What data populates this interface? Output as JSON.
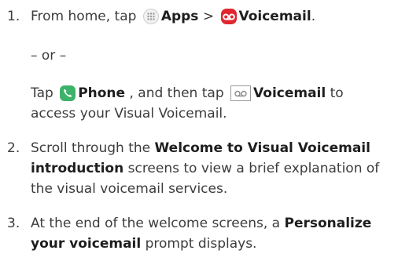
{
  "steps": [
    {
      "number": "1.",
      "line1": {
        "pre": "From home, tap",
        "apps": "Apps",
        "sep": ">",
        "voicemail": "Voicemail",
        "end": "."
      },
      "or": "– or –",
      "line2": {
        "pre": "Tap",
        "phone": "Phone",
        "mid": ", and then tap",
        "voicemail": "Voicemail",
        "post": "to"
      },
      "line3": "access your Visual Voicemail."
    },
    {
      "number": "2.",
      "lines": [
        {
          "pre": "Scroll through the",
          "bold": "Welcome to Visual Voicemail"
        },
        {
          "bold": "introduction",
          "post": "screens to view a brief explanation of"
        },
        {
          "text": "the visual voicemail services."
        }
      ]
    },
    {
      "number": "3.",
      "lines": [
        {
          "pre": "At the end of the welcome screens, a",
          "bold": "Personalize"
        },
        {
          "bold": "your voicemail",
          "post": "prompt displays."
        }
      ]
    }
  ],
  "icons": {
    "apps": "apps-grid-icon",
    "voicemail_app": "voicemail-app-icon",
    "phone": "phone-icon",
    "voicemail_tab": "voicemail-tab-icon"
  },
  "colors": {
    "text": "#3c3c3c",
    "voicemail_red": "#e0272f",
    "phone_green": "#3db26a"
  }
}
